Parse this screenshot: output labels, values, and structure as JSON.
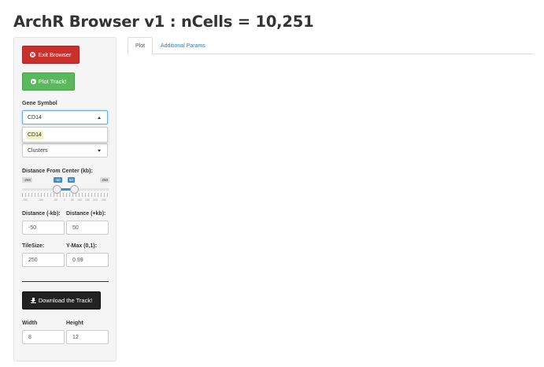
{
  "app": {
    "title": "ArchR Browser v1 : nCells = 10,251"
  },
  "sidebar": {
    "exit_button": "Exit Browser",
    "plot_button": "Plot Track!",
    "gene_symbol": {
      "label": "Gene Symbol",
      "value": "CD14",
      "dropdown_option": "CD14"
    },
    "group_select": {
      "value": "Clusters"
    },
    "distance_slider": {
      "label": "Distance From Center (kb):",
      "min_label": "-250",
      "max_label": "250",
      "from_label": "-50",
      "to_label": "50",
      "from_value": -50,
      "to_value": 50,
      "tick_labels": [
        "-250",
        "-150",
        "-50",
        "0",
        "50",
        "100",
        "150",
        "200",
        "250"
      ]
    },
    "distance_minus": {
      "label": "Distance (-kb):",
      "value": "-50"
    },
    "distance_plus": {
      "label": "Distance (+kb):",
      "value": "50"
    },
    "tile_size": {
      "label": "TileSize:",
      "value": "250"
    },
    "ymax": {
      "label": "Y-Max (0,1):",
      "value": "0.99"
    },
    "download_button": "Download the Track!",
    "width": {
      "label": "Width",
      "value": "8"
    },
    "height": {
      "label": "Height",
      "value": "12"
    }
  },
  "main": {
    "tabs": [
      {
        "label": "Plot",
        "active": true
      },
      {
        "label": "Additional Params",
        "active": false
      }
    ]
  },
  "colors": {
    "danger": "#c9302c",
    "success": "#5cb85c",
    "dark": "#222222",
    "primary": "#428bca",
    "link": "#337ab7"
  },
  "icons": {
    "exit": "times-circle-icon",
    "plot": "play-circle-icon",
    "download": "download-icon"
  }
}
